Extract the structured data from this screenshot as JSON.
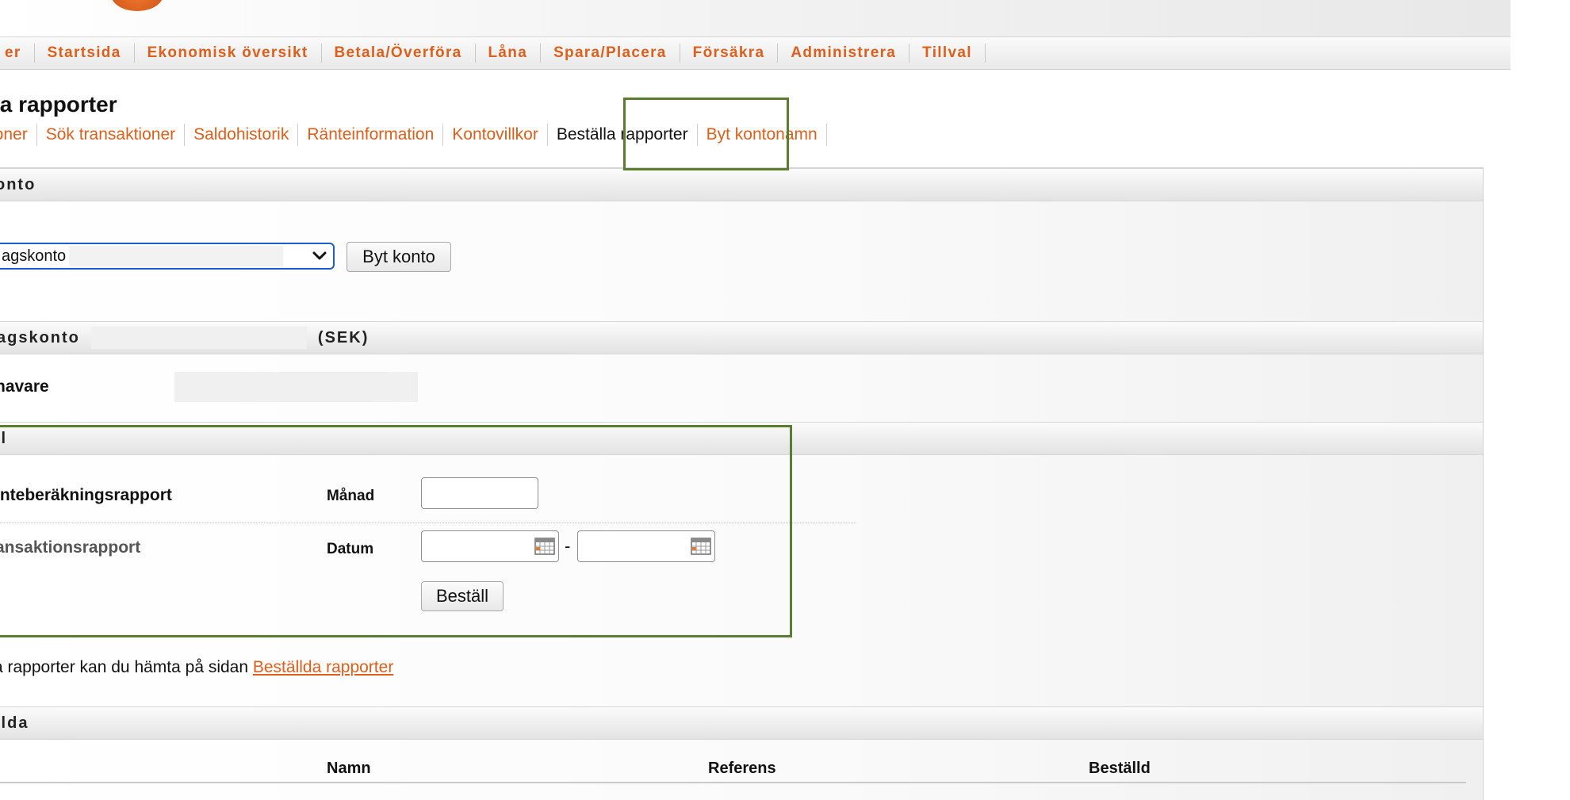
{
  "colors": {
    "accent": "#dd5f1c",
    "highlight_border": "#5a7d2f",
    "select_border": "#1f5bc9"
  },
  "main_nav": {
    "items": [
      "er",
      "Startsida",
      "Ekonomisk översikt",
      "Betala/Överföra",
      "Låna",
      "Spara/Placera",
      "Försäkra",
      "Administrera",
      "Tillval"
    ]
  },
  "page_title": "la rapporter",
  "sub_nav": {
    "items": [
      "ioner",
      "Sök transaktioner",
      "Saldohistorik",
      "Ränteinformation",
      "Kontovillkor",
      "Beställa rapporter",
      "Byt kontonamn"
    ],
    "active": "Beställa rapporter"
  },
  "section_konto": {
    "title": "onto",
    "select_value": "agskonto",
    "change_button": "Byt konto"
  },
  "section_account": {
    "title": "agskonto",
    "currency": "(SEK)",
    "holder_label": "havare"
  },
  "section_order": {
    "title": "ll",
    "interest_report": {
      "label": "inteberäkningsrapport",
      "field_label": "Månad"
    },
    "transaction_report": {
      "label": "ansaktionsrapport",
      "field_label": "Datum",
      "range_separator": "-"
    },
    "order_button": "Beställ"
  },
  "info": {
    "text": "a rapporter kan du hämta på sidan ",
    "link": "Beställda rapporter"
  },
  "section_ordered": {
    "title": "llda",
    "columns": [
      "Namn",
      "Referens",
      "Beställd"
    ]
  },
  "icons": {
    "select_chevron": "chevron-down-icon",
    "date_picker": "calendar-icon",
    "logo": "bank-logo-icon"
  }
}
